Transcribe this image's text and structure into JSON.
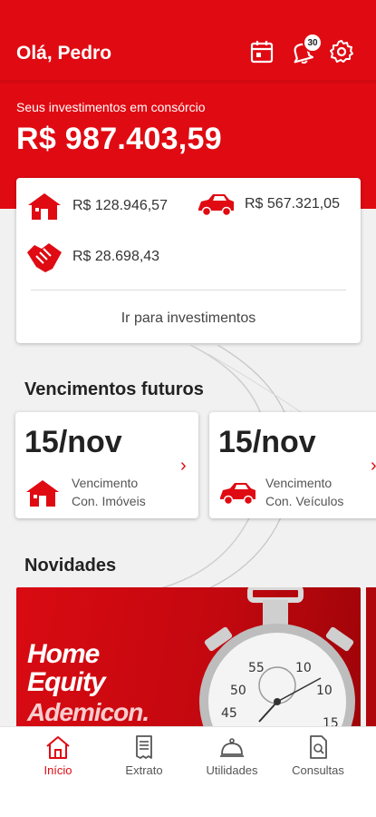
{
  "header": {
    "greeting": "Olá, Pedro",
    "notification_count": "30"
  },
  "investments": {
    "label": "Seus investimentos em consórcio",
    "total": "R$ 987.403,59",
    "items": [
      {
        "icon": "house-icon",
        "value": "R$ 128.946,57"
      },
      {
        "icon": "car-icon",
        "value": "R$ 567.321,05"
      },
      {
        "icon": "handshake-icon",
        "value": "R$ 28.698,43"
      }
    ],
    "link": "Ir para investimentos"
  },
  "upcoming": {
    "title": "Vencimentos futuros",
    "cards": [
      {
        "date": "15/nov",
        "line1": "Vencimento",
        "line2": "Con. Imóveis",
        "icon": "house-icon"
      },
      {
        "date": "15/nov",
        "line1": "Vencimento",
        "line2": "Con. Veículos",
        "icon": "car-icon"
      }
    ]
  },
  "news": {
    "title": "Novidades",
    "banner": {
      "title_line1": "Home",
      "title_line2": "Equity",
      "brand": "Ademicon."
    }
  },
  "nav": {
    "items": [
      {
        "label": "Início",
        "icon": "home-icon",
        "active": true
      },
      {
        "label": "Extrato",
        "icon": "receipt-icon"
      },
      {
        "label": "Utilidades",
        "icon": "service-bell-icon"
      },
      {
        "label": "Consultas",
        "icon": "document-search-icon"
      }
    ]
  },
  "colors": {
    "brand": "#e00a12",
    "background": "#f1f1f1"
  }
}
